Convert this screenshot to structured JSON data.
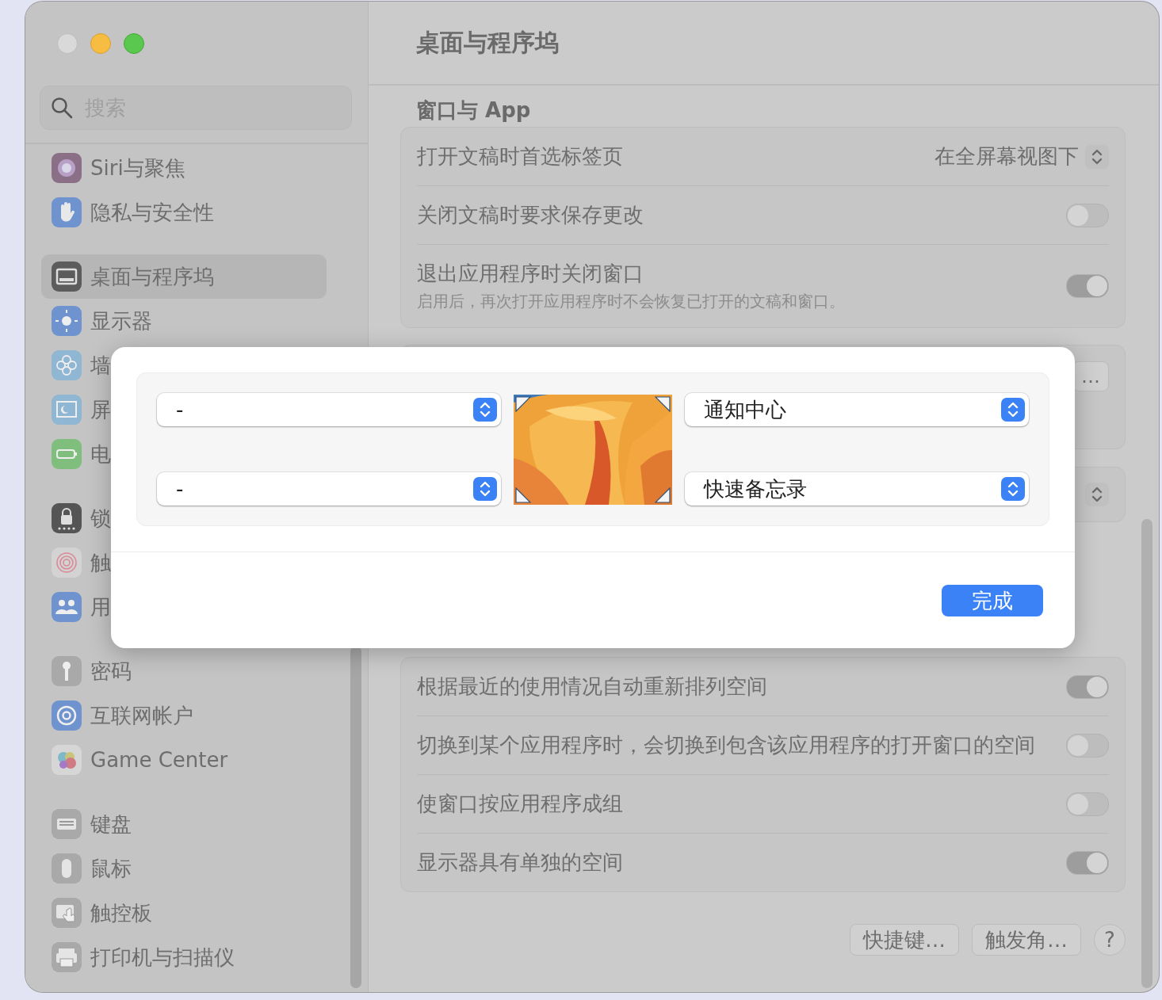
{
  "window": {
    "title": "桌面与程序坞"
  },
  "sidebar": {
    "search": {
      "placeholder": "搜索"
    },
    "groups": [
      {
        "items": [
          {
            "label": "Siri与聚焦",
            "selected": false
          },
          {
            "label": "隐私与安全性",
            "selected": false
          }
        ]
      },
      {
        "items": [
          {
            "label": "桌面与程序坞",
            "selected": true
          },
          {
            "label": "显示器",
            "selected": false
          },
          {
            "label": "墙",
            "selected": false
          },
          {
            "label": "屏",
            "selected": false
          },
          {
            "label": "电",
            "selected": false
          }
        ]
      },
      {
        "items": [
          {
            "label": "锁",
            "selected": false
          },
          {
            "label": "触",
            "selected": false
          },
          {
            "label": "用",
            "selected": false
          }
        ]
      },
      {
        "items": [
          {
            "label": "密码",
            "selected": false
          },
          {
            "label": "互联网帐户",
            "selected": false
          },
          {
            "label": "Game Center",
            "selected": false
          }
        ]
      },
      {
        "items": [
          {
            "label": "键盘",
            "selected": false
          },
          {
            "label": "鼠标",
            "selected": false
          },
          {
            "label": "触控板",
            "selected": false
          },
          {
            "label": "打印机与扫描仪",
            "selected": false
          }
        ]
      }
    ]
  },
  "section": {
    "title": "窗口与 App",
    "rows": [
      {
        "kind": "popup",
        "label": "打开文稿时首选标签页",
        "value": "在全屏幕视图下"
      },
      {
        "kind": "toggle",
        "label": "关闭文稿时要求保存更改",
        "on": false
      },
      {
        "kind": "toggle",
        "label": "退出应用程序时关闭窗口",
        "description": "启用后，再次打开应用程序时不会恢复已打开的文稿和窗口。",
        "on": true
      }
    ]
  },
  "obscured": {
    "button": "…"
  },
  "spaces": {
    "rows": [
      {
        "kind": "toggle",
        "label": "根据最近的使用情况自动重新排列空间",
        "on": true
      },
      {
        "kind": "toggle",
        "label": "切换到某个应用程序时，会切换到包含该应用程序的打开窗口的空间",
        "on": false
      },
      {
        "kind": "toggle",
        "label": "使窗口按应用程序成组",
        "on": false
      },
      {
        "kind": "toggle",
        "label": "显示器具有单独的空间",
        "on": true
      }
    ]
  },
  "footer_buttons": [
    "快捷键…",
    "触发角…",
    "?"
  ],
  "hot_corners": {
    "left": [
      {
        "value": "-"
      },
      {
        "value": "-"
      }
    ],
    "right": [
      {
        "value": "通知中心"
      },
      {
        "value": "快速备忘录"
      }
    ],
    "done": "完成"
  }
}
